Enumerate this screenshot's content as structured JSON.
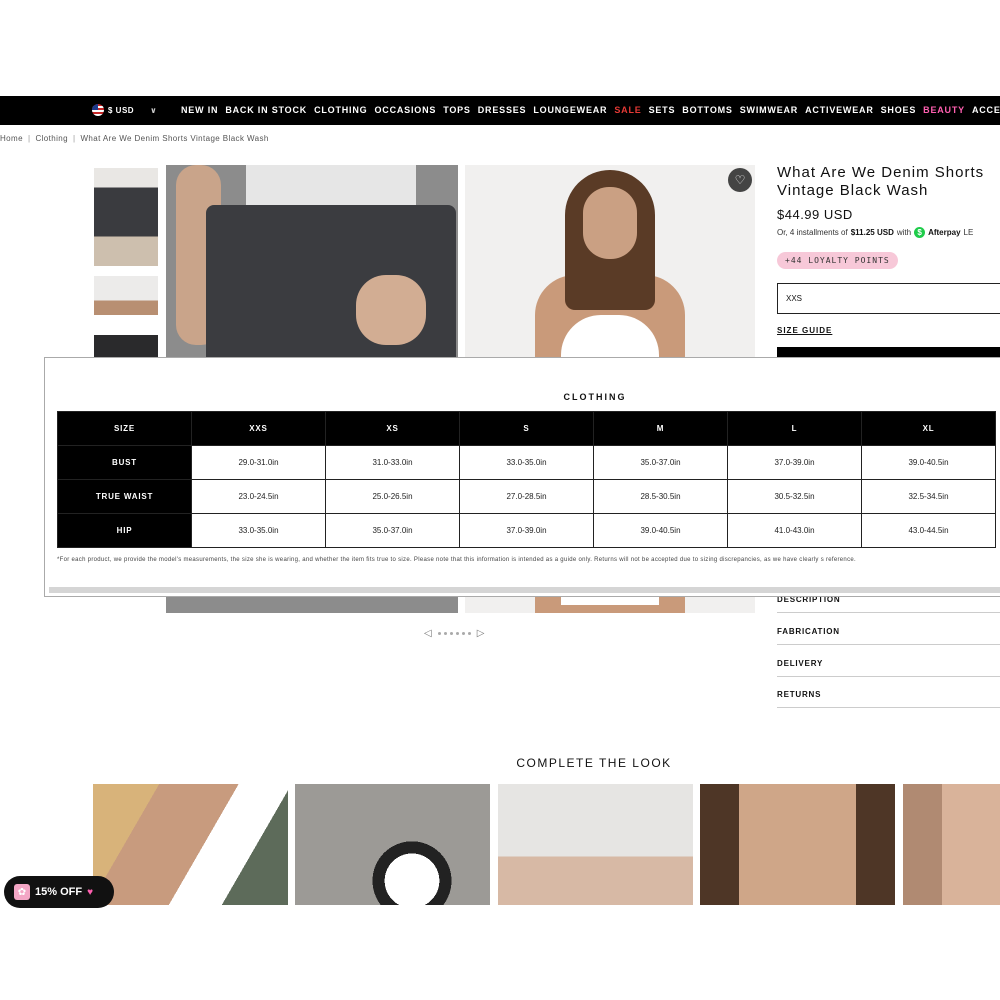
{
  "header": {
    "currency": "$ USD",
    "nav_items": [
      "NEW IN",
      "BACK IN STOCK",
      "CLOTHING",
      "OCCASIONS",
      "TOPS",
      "DRESSES",
      "LOUNGEWEAR",
      "SALE",
      "SETS",
      "BOTTOMS",
      "SWIMWEAR",
      "ACTIVEWEAR",
      "SHOES",
      "BEAUTY",
      "ACCESSO"
    ],
    "highlight_colors": {
      "sale": "#e53935",
      "beauty": "#ff5fb0"
    }
  },
  "breadcrumb": [
    "Home",
    "Clothing",
    "What Are We Denim Shorts Vintage Black Wash"
  ],
  "product": {
    "title": "What Are We Denim Shorts Vintage Black Wash",
    "price": "$44.99 USD",
    "afterpay_prefix": "Or, 4 installments of",
    "afterpay_amount": "$11.25 USD",
    "afterpay_with": "with",
    "afterpay_brand": "Afterpay",
    "afterpay_suffix": "LE",
    "loyalty": "+44 LOYALTY POINTS",
    "selected_size": "XXS",
    "size_guide": "SIZE GUIDE"
  },
  "accordion": [
    "DESCRIPTION",
    "FABRICATION",
    "DELIVERY",
    "RETURNS"
  ],
  "size_chart": {
    "title": "CLOTHING",
    "headers": [
      "SIZE",
      "XXS",
      "XS",
      "S",
      "M",
      "L",
      "XL"
    ],
    "rows": [
      {
        "label": "BUST",
        "values": [
          "29.0-31.0in",
          "31.0-33.0in",
          "33.0-35.0in",
          "35.0-37.0in",
          "37.0-39.0in",
          "39.0-40.5in"
        ]
      },
      {
        "label": "TRUE WAIST",
        "values": [
          "23.0-24.5in",
          "25.0-26.5in",
          "27.0-28.5in",
          "28.5-30.5in",
          "30.5-32.5in",
          "32.5-34.5in"
        ]
      },
      {
        "label": "HIP",
        "values": [
          "33.0-35.0in",
          "35.0-37.0in",
          "37.0-39.0in",
          "39.0-40.5in",
          "41.0-43.0in",
          "43.0-44.5in"
        ]
      }
    ],
    "footnote": "*For each product, we provide the model's measurements, the size she is wearing, and whether the item fits true to size. Please note that this information is intended as a guide only. Returns will not be accepted due to sizing discrepancies, as we have clearly s reference."
  },
  "carousel": {
    "prev": "◁",
    "next": "▷"
  },
  "complete_the_look": {
    "title": "COMPLETE THE LOOK"
  },
  "promo": {
    "label": "15% OFF"
  },
  "icons": {
    "wishlist": "heart-icon",
    "gift": "gift-icon",
    "flag": "us-flag-icon"
  }
}
